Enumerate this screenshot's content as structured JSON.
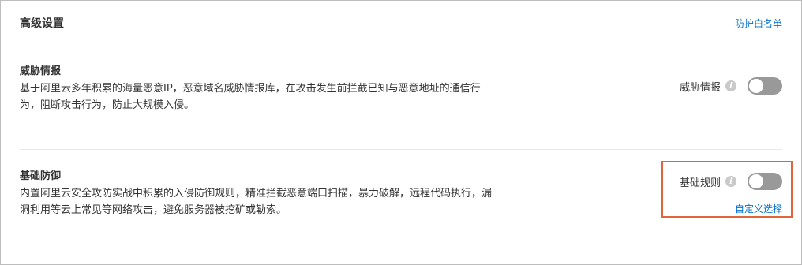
{
  "header": {
    "title": "高级设置",
    "whitelist_link": "防护白名单"
  },
  "threat_intel": {
    "title": "威胁情报",
    "description": "基于阿里云多年积累的海量恶意IP，恶意域名威胁情报库，在攻击发生前拦截已知与恶意地址的通信行为，阻断攻击行为，防止大规模入侵。",
    "switch_label": "威胁情报",
    "enabled": false
  },
  "basic_defense": {
    "title": "基础防御",
    "description": "内置阿里云安全攻防实战中积累的入侵防御规则，精准拦截恶意端口扫描，暴力破解，远程代码执行，漏洞利用等云上常见等网络攻击，避免服务器被挖矿或勒索。",
    "switch_label": "基础规则",
    "enabled": false,
    "custom_link": "自定义选择"
  },
  "icons": {
    "info": "info-icon"
  },
  "colors": {
    "link": "#0070cc",
    "toggle_off": "#999999",
    "highlight": "#e2643a"
  }
}
